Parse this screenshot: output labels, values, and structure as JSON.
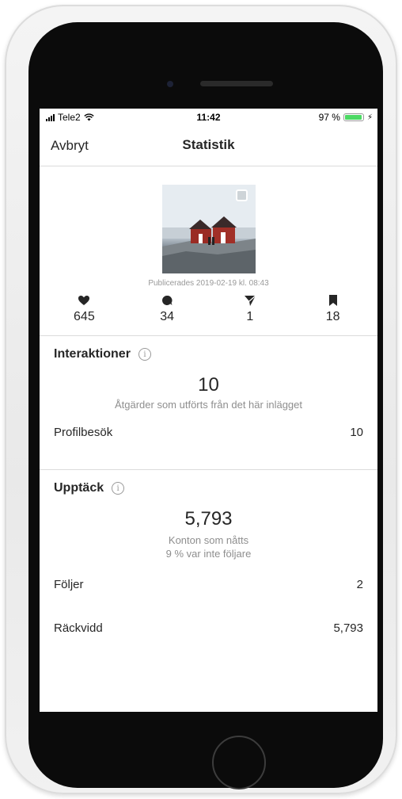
{
  "status_bar": {
    "carrier": "Tele2",
    "time": "11:42",
    "battery_text": "97 %",
    "battery_level": 0.97
  },
  "nav": {
    "cancel_label": "Avbryt",
    "title": "Statistik"
  },
  "post": {
    "published_text": "Publicerades 2019-02-19 kl. 08:43"
  },
  "counts": [
    {
      "icon": "heart-icon",
      "value": "645"
    },
    {
      "icon": "comment-icon",
      "value": "34"
    },
    {
      "icon": "share-icon",
      "value": "1"
    },
    {
      "icon": "bookmark-icon",
      "value": "18"
    }
  ],
  "interactions": {
    "title": "Interaktioner",
    "info_glyph": "i",
    "total": "10",
    "subtitle": "Åtgärder som utförts från det här inlägget",
    "rows": [
      {
        "label": "Profilbesök",
        "value": "10"
      }
    ]
  },
  "discovery": {
    "title": "Upptäck",
    "info_glyph": "i",
    "total": "5,793",
    "subtitle_line1": "Konton som nåtts",
    "subtitle_line2": "9 % var inte följare",
    "rows": [
      {
        "label": "Följer",
        "value": "2"
      },
      {
        "label": "Räckvidd",
        "value": "5,793"
      }
    ]
  },
  "colors": {
    "battery": "#4cd964",
    "text": "#262626",
    "secondary": "#8e8e8e",
    "divider": "#dbdbdb"
  }
}
